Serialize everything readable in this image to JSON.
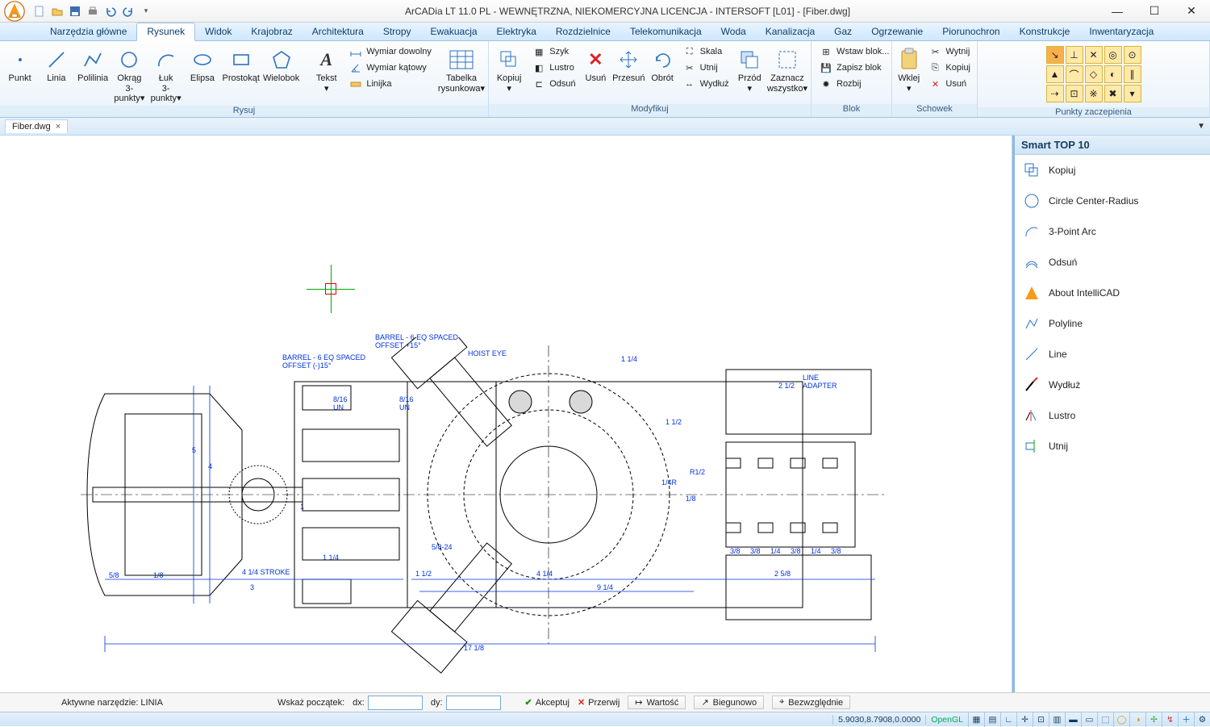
{
  "title": "ArCADia LT 11.0 PL - WEWNĘTRZNA, NIEKOMERCYJNA LICENCJA - INTERSOFT [L01] - [Fiber.dwg]",
  "tabs": {
    "t0": "Narzędzia główne",
    "t1": "Rysunek",
    "t2": "Widok",
    "t3": "Krajobraz",
    "t4": "Architektura",
    "t5": "Stropy",
    "t6": "Ewakuacja",
    "t7": "Elektryka",
    "t8": "Rozdzielnice",
    "t9": "Telekomunikacja",
    "t10": "Woda",
    "t11": "Kanalizacja",
    "t12": "Gaz",
    "t13": "Ogrzewanie",
    "t14": "Piorunochron",
    "t15": "Konstrukcje",
    "t16": "Inwentaryzacja"
  },
  "ribbon": {
    "group_draw": "Rysuj",
    "group_modify": "Modyfikuj",
    "group_block": "Blok",
    "group_clip": "Schowek",
    "group_snap": "Punkty zaczepienia",
    "point": "Punkt",
    "line": "Linia",
    "polyline": "Polilinia",
    "circle": "Okrąg",
    "circle2": "3-punkty",
    "arc": "Łuk",
    "arc2": "3-punkty",
    "ellipse": "Elipsa",
    "rect": "Prostokąt",
    "polygon": "Wielobok",
    "text": "Tekst",
    "dim_any": "Wymiar dowolny",
    "dim_ang": "Wymiar kątowy",
    "ruler": "Linijka",
    "table": "Tabelka",
    "table2": "rysunkowa",
    "copy": "Kopiuj",
    "trim_ex": "Szyk",
    "mirror": "Lustro",
    "offset": "Odsuń",
    "delete": "Usuń",
    "move": "Przesuń",
    "rotate": "Obrót",
    "scale": "Skala",
    "cut": "Utnij",
    "extend": "Wydłuż",
    "front": "Przód",
    "selall": "Zaznacz",
    "selall2": "wszystko",
    "ins_block": "Wstaw blok...",
    "save_block": "Zapisz blok",
    "explode": "Rozbij",
    "paste": "Wklej",
    "c_cut": "Wytnij",
    "c_copy": "Kopiuj",
    "c_del": "Usuń"
  },
  "doctab": {
    "name": "Fiber.dwg"
  },
  "side": {
    "title": "Smart TOP 10",
    "i0": "Kopiuj",
    "i1": "Circle Center-Radius",
    "i2": "3-Point Arc",
    "i3": "Odsuń",
    "i4": "About IntelliCAD",
    "i5": "Polyline",
    "i6": "Line",
    "i7": "Wydłuż",
    "i8": "Lustro",
    "i9": "Utnij"
  },
  "prompt": {
    "active_tool": "Aktywne narzędzie: LINIA",
    "pick_start": "Wskaż początek:",
    "dx": "dx:",
    "dy": "dy:",
    "accept": "Akceptuj",
    "cancel": "Przerwij",
    "value": "Wartość",
    "polar": "Biegunowo",
    "abs": "Bezwzględnie"
  },
  "status": {
    "coords": "5.9030,8.7908,0.0000",
    "render": "OpenGL"
  },
  "annot": {
    "a1": "BARREL - 6 EQ SPACED",
    "a1b": "OFFSET +15°",
    "a2": "BARREL - 6 EQ SPACED",
    "a2b": "OFFSET (-)15°",
    "a3": "HOIST EYE",
    "a4": "LINE",
    "a4b": "ADAPTER",
    "d1": "2 1/2",
    "d2": "1 1/4",
    "d3": "1 1/2",
    "d4": "1/4R",
    "d5": "R1/2",
    "d6": "1/8",
    "d7": "5/8",
    "d8": "1/8",
    "d9": "4 1/4 STROKE",
    "d10": "1",
    "d11": "3",
    "d12": "4",
    "d13": "5",
    "d14": "1 1/4",
    "d15": "1 1/2",
    "d16": "4 1/4",
    "d17": "9 1/4",
    "d18": "2 5/8",
    "d19": "3/8",
    "d20": "3/8",
    "d21": "1/4",
    "d22": "3/8",
    "d23": "1/4",
    "d24": "3/8",
    "d25": "17 1/8",
    "d26": "8/16",
    "d27": "UN",
    "d28": "8/16",
    "d29": "UN",
    "d30": "5/8-24"
  }
}
